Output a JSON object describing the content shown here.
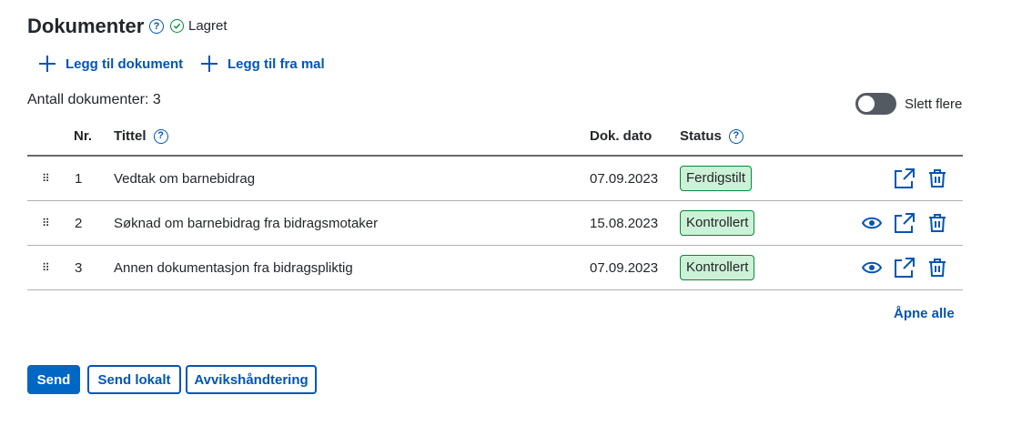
{
  "header": {
    "title": "Dokumenter",
    "help_icon": "question-icon",
    "saved_label": "Lagret"
  },
  "actions": {
    "add_document": "Legg til dokument",
    "add_from_template": "Legg til fra mal"
  },
  "summary": {
    "count_label": "Antall dokumenter: 3"
  },
  "toggle": {
    "label": "Slett flere",
    "on": false
  },
  "table": {
    "columns": {
      "nr": "Nr.",
      "title": "Tittel",
      "date": "Dok. dato",
      "status": "Status"
    },
    "rows": [
      {
        "nr": "1",
        "title": "Vedtak om barnebidrag",
        "date": "07.09.2023",
        "status": "Ferdigstilt",
        "preview": false
      },
      {
        "nr": "2",
        "title": "Søknad om barnebidrag fra bidragsmotaker",
        "date": "15.08.2023",
        "status": "Kontrollert",
        "preview": true
      },
      {
        "nr": "3",
        "title": "Annen dokumentasjon fra bidragspliktig",
        "date": "07.09.2023",
        "status": "Kontrollert",
        "preview": true
      }
    ],
    "drag_handle": "⠿"
  },
  "open_all": "Åpne alle",
  "footer": {
    "send": "Send",
    "send_local": "Send lokalt",
    "deviation": "Avvikshåndtering"
  },
  "colors": {
    "accent": "#0056b4",
    "primary_button": "#0067c5",
    "success_border": "#06893a",
    "success_bg": "#ccf1d6"
  }
}
